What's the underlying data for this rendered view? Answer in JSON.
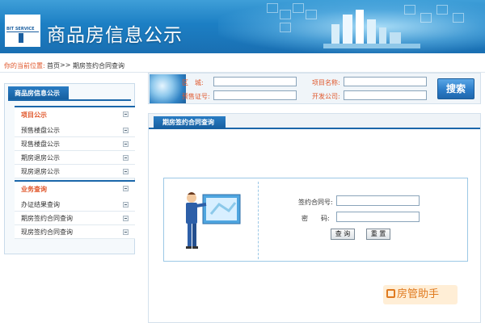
{
  "header": {
    "logo_text": "BIT SERVICE",
    "site_title": "商品房信息公示"
  },
  "breadcrumb": {
    "label": "你的当前位置:",
    "home": "首页",
    "separator": ">>",
    "current": "期房签约合同查询"
  },
  "sidebar": {
    "heading": "商品房信息公示",
    "groups": [
      {
        "title": "项目公示",
        "items": [
          "预售楼盘公示",
          "现售楼盘公示",
          "期房退房公示",
          "现房退房公示"
        ]
      },
      {
        "title": "业务查询",
        "items": [
          "办证结果查询",
          "期房签约合同查询",
          "现房签约合同查询"
        ]
      }
    ]
  },
  "search": {
    "district_label": "区　城:",
    "project_label": "项目名称:",
    "presale_label": "预售证号:",
    "developer_label": "开发公司:",
    "district_value": "",
    "project_value": "",
    "presale_value": "",
    "developer_value": "",
    "button_label": "搜索"
  },
  "content": {
    "tab_label": "期房签约合同查询",
    "form": {
      "contract_label": "签约合同号:",
      "password_label": "密　　码:",
      "contract_value": "",
      "password_value": "",
      "query_button": "查 询",
      "reset_button": "重 置"
    }
  },
  "watermark": {
    "text": "房管助手"
  },
  "colors": {
    "header_blue": "#1c7fc4",
    "accent_orange": "#e0562a",
    "nav_blue": "#1b67aa"
  }
}
